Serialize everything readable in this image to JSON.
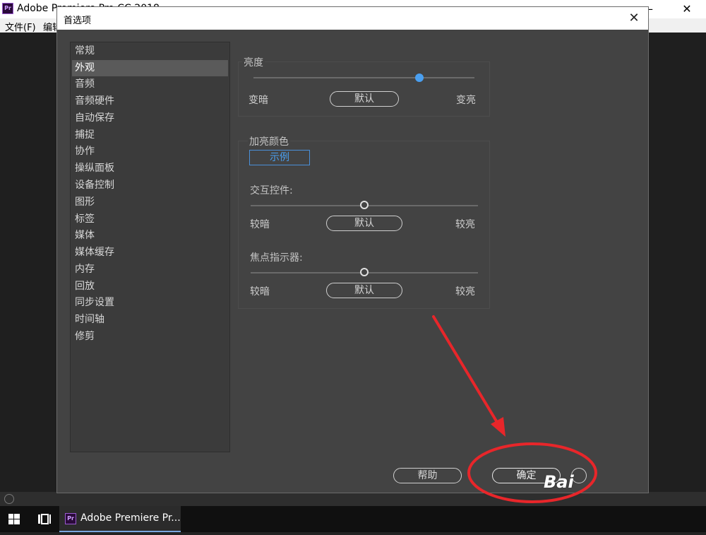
{
  "app": {
    "title": "Adobe Premiere Pro CC 2018",
    "minimize": "—",
    "close": "✕",
    "menu": [
      "文件(F)",
      "编辑"
    ]
  },
  "dialog": {
    "title": "首选项",
    "close": "✕",
    "categories": [
      "常规",
      "外观",
      "音频",
      "音频硬件",
      "自动保存",
      "捕捉",
      "协作",
      "操纵面板",
      "设备控制",
      "图形",
      "标签",
      "媒体",
      "媒体缓存",
      "内存",
      "回放",
      "同步设置",
      "时间轴",
      "修剪"
    ],
    "selected_category": "外观",
    "brightness": {
      "label": "亮度",
      "left": "变暗",
      "default": "默认",
      "right": "变亮",
      "value": 0.75
    },
    "highlight_color": {
      "label": "加亮颜色",
      "sample": "示例"
    },
    "interactive_controls": {
      "label": "交互控件:",
      "left": "较暗",
      "default": "默认",
      "right": "较亮",
      "value": 0.5
    },
    "focus_indicators": {
      "label": "焦点指示器:",
      "left": "较暗",
      "default": "默认",
      "right": "较亮",
      "value": 0.5
    },
    "buttons": {
      "help": "帮助",
      "ok": "确定"
    }
  },
  "taskbar": {
    "app_label": "Adobe Premiere Pr..."
  },
  "watermark": "Bai",
  "colors": {
    "accent_blue": "#4a9ff0",
    "annotation_red": "#e8262a"
  }
}
